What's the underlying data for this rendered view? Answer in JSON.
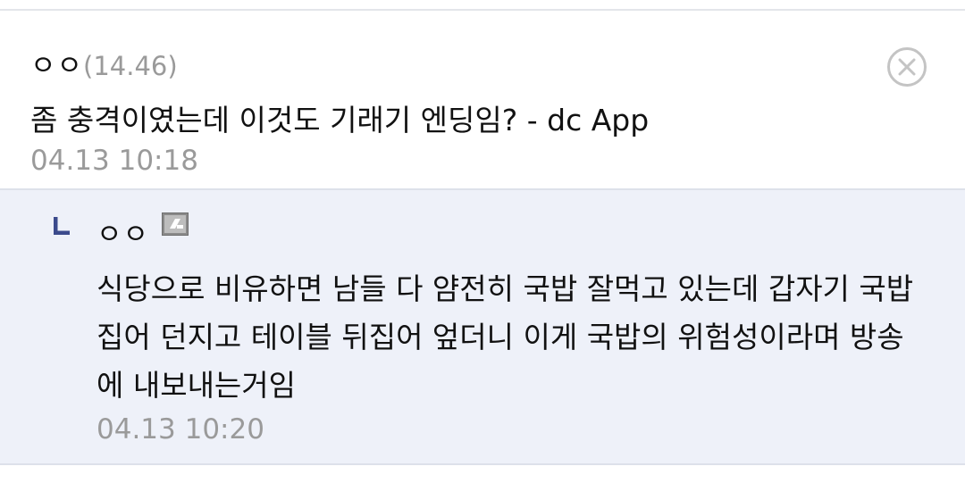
{
  "comment": {
    "author_name": "ㅇㅇ",
    "author_ip": "(14.46)",
    "text": "좀 충격이였는데 이것도 기래기 엔딩임? - dc App",
    "date": "04.13 10:18",
    "close_icon": "close-circle-icon"
  },
  "reply": {
    "indicator_icon": "reply-arrow-icon",
    "author_name": "ㅇㅇ",
    "badge_icon": "gallery-badge-icon",
    "text_lines": [
      "식당으로 비유하면 남들 다 얌전히 국밥 잘먹고 있는데 갑자기 국밥",
      "집어 던지고 테이블 뒤집어 엎더니 이게 국밥의 위험성이라며 방송",
      "에 내보내는거임"
    ],
    "date": "04.13 10:20"
  },
  "colors": {
    "text": "#111111",
    "muted": "#9a9a9a",
    "reply_bg": "#eef1f9",
    "reply_arrow": "#3b4a8c",
    "divider": "#dde1ea"
  }
}
